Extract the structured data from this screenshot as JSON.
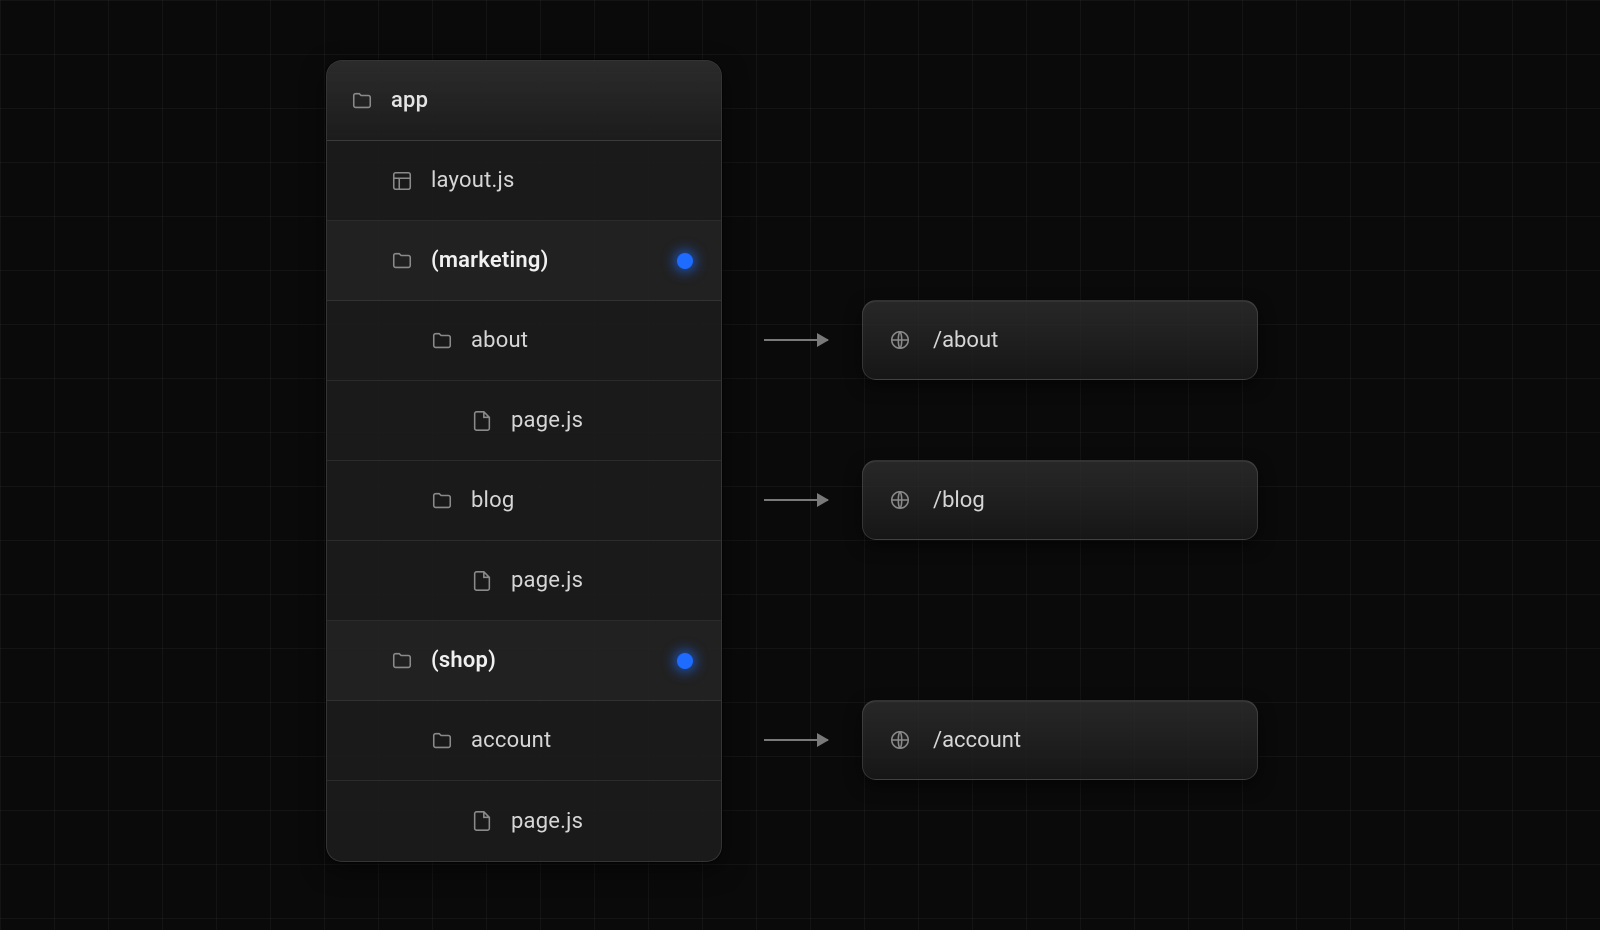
{
  "tree": {
    "root": "app",
    "items": [
      {
        "kind": "file-layout",
        "label": "layout.js",
        "indent": 2
      },
      {
        "kind": "folder",
        "label": "(marketing)",
        "indent": 2,
        "group": true,
        "dot": true
      },
      {
        "kind": "folder",
        "label": "about",
        "indent": 3,
        "route": "/about"
      },
      {
        "kind": "file",
        "label": "page.js",
        "indent": 4
      },
      {
        "kind": "folder",
        "label": "blog",
        "indent": 3,
        "route": "/blog"
      },
      {
        "kind": "file",
        "label": "page.js",
        "indent": 4
      },
      {
        "kind": "folder",
        "label": "(shop)",
        "indent": 2,
        "group": true,
        "dot": true
      },
      {
        "kind": "folder",
        "label": "account",
        "indent": 3,
        "route": "/account"
      },
      {
        "kind": "file",
        "label": "page.js",
        "indent": 4
      }
    ]
  },
  "routes": [
    {
      "path": "/about"
    },
    {
      "path": "/blog"
    },
    {
      "path": "/account"
    }
  ],
  "colors": {
    "dot": "#1e6bff",
    "bg": "#0a0a0a"
  }
}
